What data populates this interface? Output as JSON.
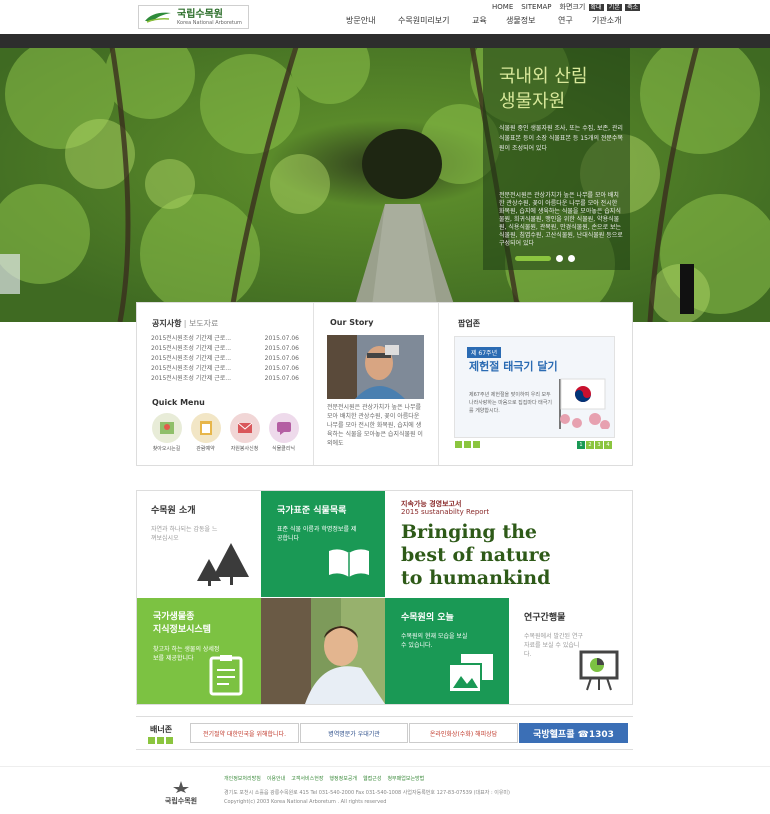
{
  "header": {
    "logo_title": "국립수목원",
    "logo_sub": "Korea National Arboretum",
    "util": {
      "home": "HOME",
      "sitemap": "SITEMAP",
      "font_label": "화면크기",
      "font_up": "확대",
      "font_default": "기본",
      "font_down": "축소"
    },
    "nav": [
      "방문안내",
      "수목원미리보기",
      "교육",
      "생물정보",
      "연구",
      "기관소개"
    ]
  },
  "hero": {
    "title_line1": "국내외 산림",
    "title_line2": "생물자원",
    "text1": "식물원 중인 생물자원 조사, 또는 수집, 보존, 관리 식물표본 등이 소장 식물표본 등 15개의 전문수목원이 조성되어 있다",
    "text2": "전문전시원은 관상가치가 높은 나무를 모아 배치한 관상수원, 꽃이 아름다운 나무를 모아 전시한 화목원, 습지에 생육하는 식물을 모아놓은 습지식물원, 희귀식물원, 맹인을 위한 식물원, 약용식물원, 식용식물원, 관목원, 만경식물원, 손으로 보는 식물원, 침엽수원, 고산식물원, 난대식물원 등으로 구성되어 있다"
  },
  "notice": {
    "tab_active": "공지사항",
    "tab_inactive": "보도자료",
    "items": [
      {
        "title": "2015전시원조성 기간제 근로...",
        "date": "2015.07.06"
      },
      {
        "title": "2015전시원조성 기간제 근로...",
        "date": "2015.07.06"
      },
      {
        "title": "2015전시원조성 기간제 근로...",
        "date": "2015.07.06"
      },
      {
        "title": "2015전시원조성 기간제 근로...",
        "date": "2015.07.06"
      },
      {
        "title": "2015전시원조성 기간제 근로...",
        "date": "2015.07.06"
      }
    ]
  },
  "quick": {
    "title": "Quick Menu",
    "items": [
      {
        "label": "찾아오시는길",
        "icon": "map-icon",
        "color": "#8fbf6a"
      },
      {
        "label": "관람예약",
        "icon": "clipboard-icon",
        "color": "#e7b64a"
      },
      {
        "label": "자원봉사신청",
        "icon": "mail-icon",
        "color": "#d9575b"
      },
      {
        "label": "식물클리닉",
        "icon": "chat-icon",
        "color": "#b45fa3"
      }
    ]
  },
  "story": {
    "title": "Our Story",
    "text": "전문전시원은 관상가치가 높은 나무를 모아 배치한 관상수원, 꽃이 아름다운 나무를 모아 전시한 화목원, 습지에 생육하는 식물을 모아놓은 습지식물원 이외에도"
  },
  "popup": {
    "title": "팝업존",
    "badge": "제 67주년",
    "headline": "제헌절 태극기 달기",
    "text": "제67주년 제헌절을 맞이하여 우리 모두 나라사랑하는 마음으로 집집마다 태극기를 게양합시다.",
    "pages": [
      "1",
      "2",
      "3",
      "4"
    ]
  },
  "tiles": {
    "intro": {
      "title": "수목원 소개",
      "desc": "자연과 하나되는 감동을 느껴보십시오"
    },
    "plants": {
      "title": "국가표준 식물목록",
      "desc": "표준 식물 이름과 학명정보를 제공합니다"
    },
    "report": {
      "label1": "지속가능 경영보고서",
      "label2": "2015 sustanabilty Report",
      "headline1": "Bringing the",
      "headline2": "best of nature",
      "headline3": "to humankind"
    },
    "bio": {
      "title1": "국가생물종",
      "title2": "지식정보시스템",
      "desc": "찾고자 하는 생물의 상세정보를 제공합니다"
    },
    "today": {
      "title": "수목원의 오늘",
      "desc": "수목원의 현재 모습을 보실 수 있습니다."
    },
    "pubs": {
      "title": "연구간행물",
      "desc": "수목원에서 발간된 연구자료를 보실 수 있습니다."
    }
  },
  "banners": {
    "title": "배너존",
    "items": [
      {
        "text": "전기절약 대한민국을 위해합니다."
      },
      {
        "text": "병역명문가 우대기관"
      },
      {
        "text": "온라인화상(수화) 해피상담"
      },
      {
        "text": "국방헬프콜 ☎1303"
      }
    ]
  },
  "footer": {
    "logo": "국립수목원",
    "links": [
      "개인정보처리방침",
      "이용안내",
      "고객서비스헌장",
      "행정정보공개",
      "웹접근성",
      "청부패업보는방법"
    ],
    "address": "경기도 포천시 소흘읍 광릉수목원로 415 Tel 031-540-2000 Fax 031-540-1008 사업자등록번호 127-83-07539 (대표자 : 이유미)",
    "copyright": "Copyright(c) 2003 Korea National Arboretum . All rights reserved"
  },
  "colors": {
    "green": "#1a9955",
    "lime": "#7cc242",
    "brand": "#2c6e2a"
  }
}
